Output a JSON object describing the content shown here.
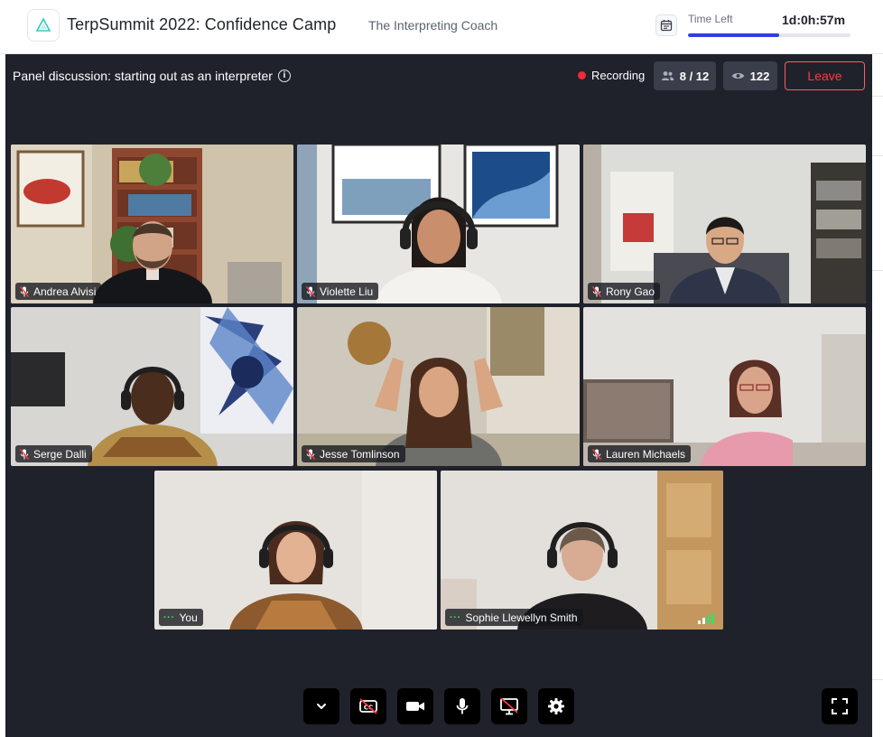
{
  "header": {
    "event_title": "TerpSummit 2022: Confidence Camp",
    "organizer": "The Interpreting Coach",
    "time_left_label": "Time Left",
    "time_left_value": "1d:0h:57m",
    "time_left_progress": 0.56,
    "accent_color": "#2f3fe0"
  },
  "session": {
    "title": "Panel discussion: starting out as an interpreter",
    "recording_label": "Recording",
    "participants": "8 / 12",
    "viewers": "122",
    "leave_label": "Leave"
  },
  "participants": [
    {
      "name": "Andrea Alvisi",
      "status_icon": "mic-muted-icon"
    },
    {
      "name": "Violette Liu",
      "status_icon": "mic-muted-icon"
    },
    {
      "name": "Rony Gao",
      "status_icon": "mic-muted-icon"
    },
    {
      "name": "Serge Dalli",
      "status_icon": "mic-muted-icon"
    },
    {
      "name": "Jesse Tomlinson",
      "status_icon": "mic-muted-icon"
    },
    {
      "name": "Lauren Michaels",
      "status_icon": "mic-muted-icon"
    },
    {
      "name": "You",
      "status_icon": "more-dots-icon"
    },
    {
      "name": "Sophie Llewellyn Smith",
      "status_icon": "more-dots-icon"
    }
  ],
  "controls": [
    "collapse-chevron-icon",
    "captions-off-icon",
    "camera-icon",
    "microphone-icon",
    "screen-share-off-icon",
    "settings-gear-icon",
    "fullscreen-icon"
  ]
}
